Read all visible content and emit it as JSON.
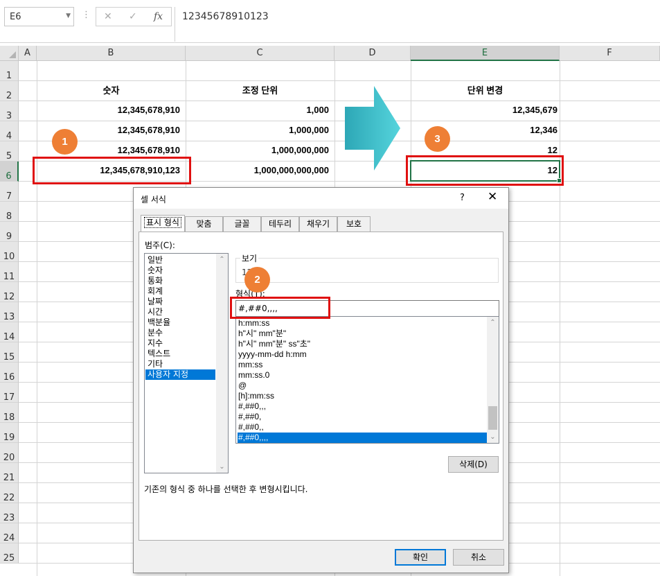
{
  "formula_bar": {
    "name_box": "E6",
    "cancel_icon": "✕",
    "enter_icon": "✓",
    "fx": "fx",
    "content": "12345678910123"
  },
  "columns": [
    "A",
    "B",
    "C",
    "D",
    "E",
    "F"
  ],
  "rows": [
    "1",
    "2",
    "3",
    "4",
    "5",
    "6",
    "7",
    "8",
    "9",
    "10",
    "11",
    "12",
    "13",
    "14",
    "15",
    "16",
    "17",
    "18",
    "19",
    "20",
    "21",
    "22",
    "23",
    "24",
    "25"
  ],
  "selected": {
    "column": "E",
    "row": "6"
  },
  "cells": {
    "B2": "숫자",
    "C2": "조정 단위",
    "E2": "단위 변경",
    "B3": "12,345,678,910",
    "C3": "1,000",
    "E3": "12,345,679",
    "B4": "12,345,678,910",
    "C4": "1,000,000",
    "E4": "12,346",
    "B5": "12,345,678,910",
    "C5": "1,000,000,000",
    "E5": "12",
    "B6": "12,345,678,910,123",
    "C6": "1,000,000,000,000",
    "E6": "12"
  },
  "badges": [
    "1",
    "2",
    "3"
  ],
  "colors": {
    "accent_red": "#e01010",
    "badge_orange": "#ee7f35",
    "arrow_teal": "#3bbfca",
    "excel_green": "#217346",
    "selection_blue": "#0078d7"
  },
  "dialog": {
    "title": "셀 서식",
    "help": "?",
    "close": "✕",
    "tabs": [
      "표시 형식",
      "맞춤",
      "글꼴",
      "테두리",
      "채우기",
      "보호"
    ],
    "category_label": "범주(C):",
    "categories": [
      "일반",
      "숫자",
      "통화",
      "회계",
      "날짜",
      "시간",
      "백분율",
      "분수",
      "지수",
      "텍스트",
      "기타",
      "사용자 지정"
    ],
    "selected_category": "사용자 지정",
    "preview_label": "보기",
    "preview_value": "12",
    "type_label": "형식(T):",
    "type_value": "#,##0,,,,",
    "formats": [
      "h:mm:ss",
      "h\"시\" mm\"분\"",
      "h\"시\" mm\"분\" ss\"초\"",
      "yyyy-mm-dd h:mm",
      "mm:ss",
      "mm:ss.0",
      "@",
      "[h]:mm:ss",
      "#,##0,,,",
      "#,##0,",
      "#,##0,,",
      "#,##0,,,,"
    ],
    "selected_format": "#,##0,,,,",
    "delete_button": "삭제(D)",
    "description": "기존의 형식 중 하나를 선택한 후 변형시킵니다.",
    "ok_button": "확인",
    "cancel_button": "취소"
  }
}
